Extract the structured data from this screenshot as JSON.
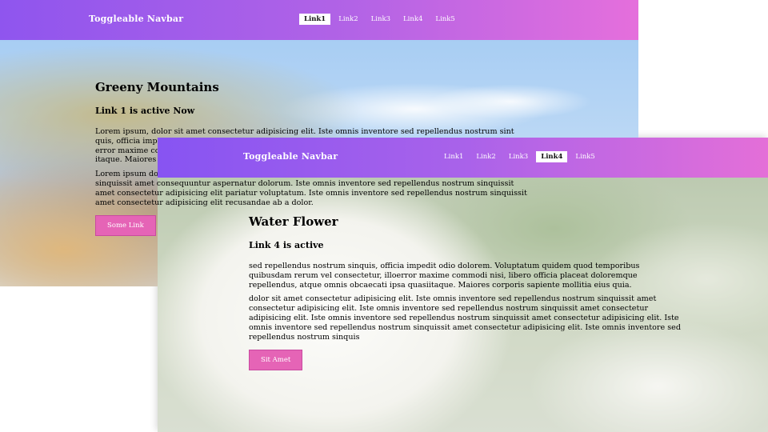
{
  "windows": [
    {
      "navbar": {
        "brand": "Toggleable Navbar",
        "links": [
          "Link1",
          "Link2",
          "Link3",
          "Link4",
          "Link5"
        ],
        "active_link": "Link1"
      },
      "hero": {
        "title": "Greeny Mountains",
        "subtitle": "Link 1 is active Now",
        "paragraphs": [
          "Lorem ipsum, dolor sit amet consectetur adipisicing elit. Iste omnis inventore sed repellendus nostrum sint quis, officia impedit odio dolorem. Voluptatum quidem quod temporibus quibusdam rerum vel consectetur, illo error maxime commodi nisi, libero officia placeat doloremque repellendus, atque omnis obcaecati ipsa quasi itaque. Maiores corporis sapiente mollitia eius quia.",
          "Lorem ipsum dolor sit amet consectetur adipisicing elit. Iste omnis inventore sed repellendus nostrum sinquissit amet consequuntur aspernatur dolorum. Iste omnis inventore sed repellendus nostrum sinquissit amet consectetur adipisicing elit pariatur voluptatum. Iste omnis inventore sed repellendus nostrum sinquissit amet consectetur adipisicing elit recusandae ab a dolor."
        ],
        "button": "Some Link"
      }
    },
    {
      "navbar": {
        "brand": "Toggleable Navbar",
        "links": [
          "Link1",
          "Link2",
          "Link3",
          "Link4",
          "Link5"
        ],
        "active_link": "Link4"
      },
      "hero": {
        "title": "Water Flower",
        "subtitle": "Link 4 is active",
        "paragraphs": [
          "sed repellendus nostrum sinquis, officia impedit odio dolorem. Voluptatum quidem quod temporibus quibusdam rerum vel consectetur, illoerror maxime commodi nisi, libero officia placeat doloremque repellendus, atque omnis obcaecati ipsa quasiitaque. Maiores corporis sapiente mollitia eius quia.",
          "dolor sit amet consectetur adipisicing elit. Iste omnis inventore sed repellendus nostrum sinquissit amet consectetur adipisicing elit. Iste omnis inventore sed repellendus nostrum sinquissit amet consectetur adipisicing elit. Iste omnis inventore sed repellendus nostrum sinquissit amet consectetur adipisicing elit. Iste omnis inventore sed repellendus nostrum sinquissit amet consectetur adipisicing elit. Iste omnis inventore sed repellendus nostrum sinquis"
        ],
        "button": "Sit Amet"
      }
    }
  ]
}
